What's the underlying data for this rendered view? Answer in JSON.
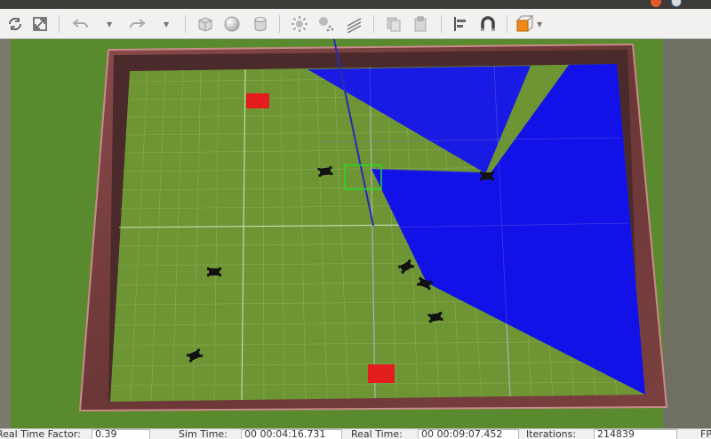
{
  "status": {
    "rtf_label": "Real Time Factor:",
    "rtf_value": "0.39",
    "sim_label": "Sim Time:",
    "sim_value": "00 00:04:16.731",
    "real_label": "Real Time:",
    "real_value": "00 00:09:07.452",
    "iter_label": "Iterations:",
    "iter_value": "214839",
    "fps_label": "FPS:"
  },
  "toolbar": {
    "items": [
      "refresh-icon",
      "fullscreen-icon",
      "undo-icon",
      "redo-icon",
      "box-icon",
      "sphere-icon",
      "cylinder-icon",
      "point-light-icon",
      "spot-light-icon",
      "directional-light-icon",
      "copy-icon",
      "paste-icon",
      "align-icon",
      "magnet-icon",
      "view-angle-icon"
    ]
  },
  "colors": {
    "ground": "#5a8b2f",
    "floor": "#6f9534",
    "wall": "#6e3a3a",
    "laser": "#1414f0",
    "goal": "#e31d1d",
    "selection": "#22dd22"
  }
}
